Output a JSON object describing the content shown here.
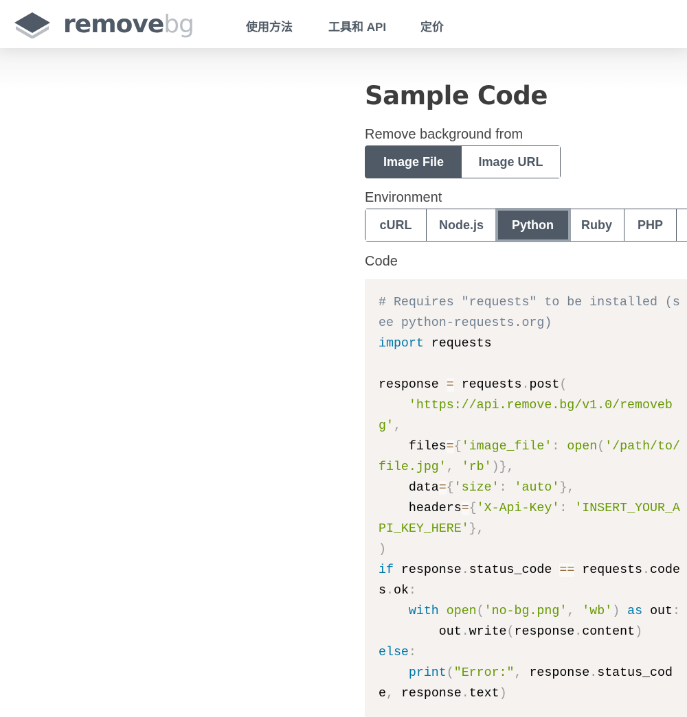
{
  "header": {
    "logo": {
      "main": "remove",
      "accent": "bg"
    },
    "nav": [
      {
        "label": "使用方法"
      },
      {
        "label": "工具和 API"
      },
      {
        "label": "定价"
      }
    ]
  },
  "main": {
    "title": "Sample Code",
    "source_label": "Remove background from",
    "source_options": [
      {
        "label": "Image File",
        "active": true
      },
      {
        "label": "Image URL",
        "active": false
      }
    ],
    "env_label": "Environment",
    "env_options": [
      {
        "label": "cURL"
      },
      {
        "label": "Node.js"
      },
      {
        "label": "Python",
        "active": true
      },
      {
        "label": "Ruby"
      },
      {
        "label": "PHP"
      },
      {
        "label": ""
      }
    ],
    "code_label": "Code",
    "code_lines": [
      [
        [
          "comment",
          "# Requires \"requests\" to be installed (see python-requests.org)"
        ]
      ],
      [
        [
          "keyword",
          "import"
        ],
        [
          "plain",
          " requests"
        ]
      ],
      [],
      [
        [
          "plain",
          "response "
        ],
        [
          "operator",
          "="
        ],
        [
          "plain",
          " requests"
        ],
        [
          "punct",
          "."
        ],
        [
          "plain",
          "post"
        ],
        [
          "punct",
          "("
        ]
      ],
      [
        [
          "plain",
          "    "
        ],
        [
          "string",
          "'https://api.remove.bg/v1.0/removebg'"
        ],
        [
          "punct",
          ","
        ]
      ],
      [
        [
          "plain",
          "    files"
        ],
        [
          "operator",
          "="
        ],
        [
          "punct",
          "{"
        ],
        [
          "string",
          "'image_file'"
        ],
        [
          "punct",
          ":"
        ],
        [
          "plain",
          " "
        ],
        [
          "func",
          "open"
        ],
        [
          "punct",
          "("
        ],
        [
          "string",
          "'/path/to/file.jpg'"
        ],
        [
          "punct",
          ","
        ],
        [
          "plain",
          " "
        ],
        [
          "string",
          "'rb'"
        ],
        [
          "punct",
          ")},"
        ]
      ],
      [
        [
          "plain",
          "    data"
        ],
        [
          "operator",
          "="
        ],
        [
          "punct",
          "{"
        ],
        [
          "string",
          "'size'"
        ],
        [
          "punct",
          ":"
        ],
        [
          "plain",
          " "
        ],
        [
          "string",
          "'auto'"
        ],
        [
          "punct",
          "},"
        ]
      ],
      [
        [
          "plain",
          "    headers"
        ],
        [
          "operator",
          "="
        ],
        [
          "punct",
          "{"
        ],
        [
          "string",
          "'X-Api-Key'"
        ],
        [
          "punct",
          ":"
        ],
        [
          "plain",
          " "
        ],
        [
          "string",
          "'INSERT_YOUR_API_KEY_HERE'"
        ],
        [
          "punct",
          "},"
        ]
      ],
      [
        [
          "punct",
          ")"
        ]
      ],
      [
        [
          "keyword",
          "if"
        ],
        [
          "plain",
          " response"
        ],
        [
          "punct",
          "."
        ],
        [
          "plain",
          "status_code "
        ],
        [
          "operator",
          "=="
        ],
        [
          "plain",
          " requests"
        ],
        [
          "punct",
          "."
        ],
        [
          "plain",
          "codes"
        ],
        [
          "punct",
          "."
        ],
        [
          "plain",
          "ok"
        ],
        [
          "punct",
          ":"
        ]
      ],
      [
        [
          "plain",
          "    "
        ],
        [
          "keyword",
          "with"
        ],
        [
          "plain",
          " "
        ],
        [
          "func",
          "open"
        ],
        [
          "punct",
          "("
        ],
        [
          "string",
          "'no-bg.png'"
        ],
        [
          "punct",
          ","
        ],
        [
          "plain",
          " "
        ],
        [
          "string",
          "'wb'"
        ],
        [
          "punct",
          ")"
        ],
        [
          "plain",
          " "
        ],
        [
          "keyword",
          "as"
        ],
        [
          "plain",
          " out"
        ],
        [
          "punct",
          ":"
        ]
      ],
      [
        [
          "plain",
          "        out"
        ],
        [
          "punct",
          "."
        ],
        [
          "plain",
          "write"
        ],
        [
          "punct",
          "("
        ],
        [
          "plain",
          "response"
        ],
        [
          "punct",
          "."
        ],
        [
          "plain",
          "content"
        ],
        [
          "punct",
          ")"
        ]
      ],
      [
        [
          "keyword",
          "else"
        ],
        [
          "punct",
          ":"
        ]
      ],
      [
        [
          "plain",
          "    "
        ],
        [
          "keyword",
          "print"
        ],
        [
          "punct",
          "("
        ],
        [
          "string",
          "\"Error:\""
        ],
        [
          "punct",
          ","
        ],
        [
          "plain",
          " response"
        ],
        [
          "punct",
          "."
        ],
        [
          "plain",
          "status_code"
        ],
        [
          "punct",
          ","
        ],
        [
          "plain",
          " response"
        ],
        [
          "punct",
          "."
        ],
        [
          "plain",
          "text"
        ],
        [
          "punct",
          ")"
        ]
      ]
    ]
  },
  "colors": {
    "brand": "#4f5a66",
    "brand_light": "#b9bec4",
    "code_bg": "#f5f2f0",
    "keyword": "#0077aa",
    "string": "#669900",
    "comment": "#708090"
  }
}
